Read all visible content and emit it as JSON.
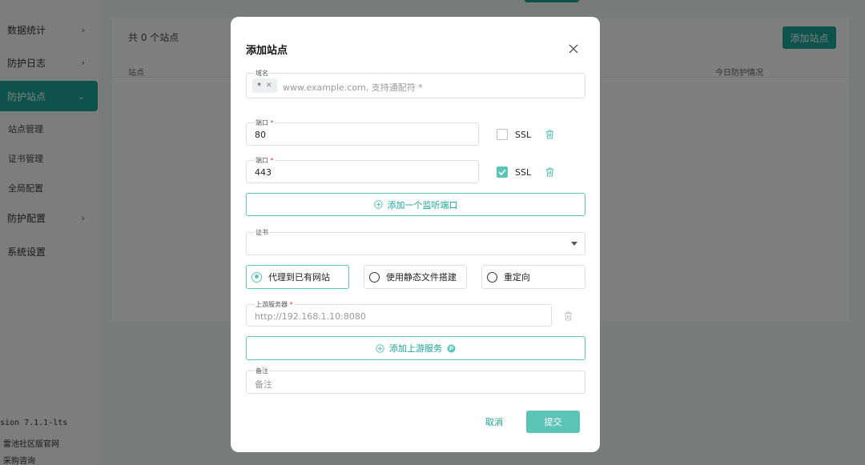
{
  "sidebar": {
    "items": [
      {
        "label": "数据统计",
        "chevron": "›"
      },
      {
        "label": "防护日志",
        "chevron": "›"
      },
      {
        "label": "防护站点",
        "chevron": "⌄"
      },
      {
        "label": "防护配置",
        "chevron": "›"
      },
      {
        "label": "系统设置"
      }
    ],
    "sub_items": [
      "站点管理",
      "证书管理",
      "全局配置"
    ],
    "footer": [
      "sion 7.1.1-lts",
      "雷池社区版官网",
      "采购咨询"
    ]
  },
  "main": {
    "count_text": "共 0 个站点",
    "add_site_label": "添加站点",
    "columns": [
      "站点",
      "今日防护情况"
    ]
  },
  "modal": {
    "title": "添加站点",
    "domain": {
      "label": "域名",
      "chip": "*",
      "placeholder": "www.example.com, 支持通配符 *"
    },
    "ports": [
      {
        "label": "端口",
        "value": "80",
        "ssl_label": "SSL",
        "ssl_checked": false
      },
      {
        "label": "端口",
        "value": "443",
        "ssl_label": "SSL",
        "ssl_checked": true
      }
    ],
    "add_port_label": "添加一个监听端口",
    "cert": {
      "label": "证书",
      "value": ""
    },
    "modes": [
      {
        "label": "代理到已有网站",
        "selected": true
      },
      {
        "label": "使用静态文件搭建",
        "selected": false
      },
      {
        "label": "重定向",
        "selected": false
      }
    ],
    "upstream": {
      "label": "上游服务器",
      "placeholder": "http://192.168.1.10:8080"
    },
    "add_upstream_label": "添加上游服务",
    "note": {
      "label": "备注",
      "placeholder": "备注"
    },
    "cancel_label": "取消",
    "submit_label": "提交"
  },
  "colors": {
    "accent": "#1aa696",
    "accent_light": "#5cc3b7",
    "required": "#e53935"
  }
}
